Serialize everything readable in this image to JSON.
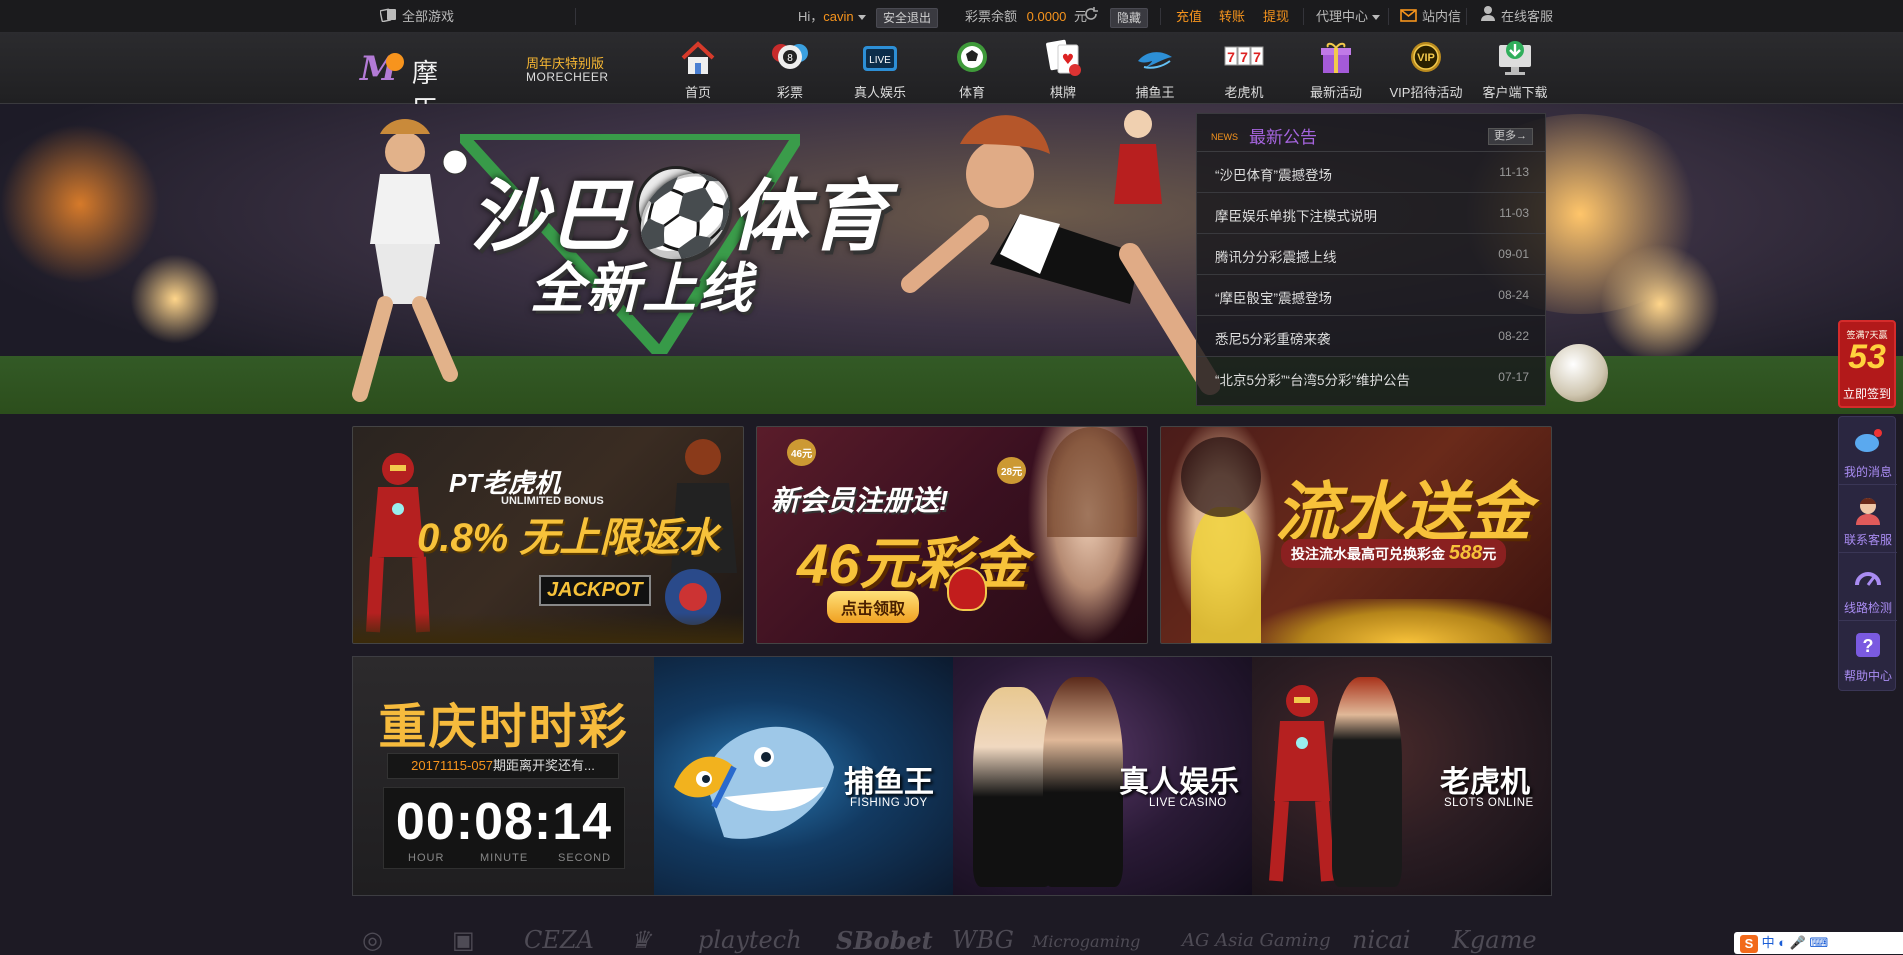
{
  "topbar": {
    "all_games": "全部游戏",
    "greeting": "Hi，",
    "username": "cavin",
    "logout": "安全退出",
    "balance_label": "彩票余额",
    "balance_value": "0.0000",
    "balance_unit": "元",
    "hide": "隐藏",
    "deposit": "充值",
    "transfer": "转账",
    "withdraw": "提现",
    "agent_center": "代理中心",
    "messages": "站内信",
    "online_service": "在线客服"
  },
  "header": {
    "logo_m": "M",
    "logo_name": "摩臣娱乐",
    "logo_edition": "周年庆特别版",
    "logo_en": "MORECHEER",
    "nav": [
      {
        "label": "首页",
        "icon": "house-icon"
      },
      {
        "label": "彩票",
        "icon": "lottery-ball-icon"
      },
      {
        "label": "真人娱乐",
        "icon": "live-tv-icon"
      },
      {
        "label": "体育",
        "icon": "soccer-ball-icon"
      },
      {
        "label": "棋牌",
        "icon": "playing-cards-icon"
      },
      {
        "label": "捕鱼王",
        "icon": "fish-icon"
      },
      {
        "label": "老虎机",
        "icon": "slot-777-icon"
      },
      {
        "label": "最新活动",
        "icon": "gift-icon"
      },
      {
        "label": "VIP招待活动",
        "icon": "vip-badge-icon"
      },
      {
        "label": "客户端下载",
        "icon": "download-icon"
      }
    ]
  },
  "banner": {
    "title": "沙巴⚽体育",
    "subtitle": "全新上线"
  },
  "news": {
    "tag": "NEWS",
    "title": "最新公告",
    "more": "更多→",
    "items": [
      {
        "text": "“沙巴体育”震撼登场",
        "date": "11-13"
      },
      {
        "text": "摩臣娱乐单挑下注模式说明",
        "date": "11-03"
      },
      {
        "text": "腾讯分分彩震撼上线",
        "date": "09-01"
      },
      {
        "text": "“摩臣骰宝”震撼登场",
        "date": "08-24"
      },
      {
        "text": "悉尼5分彩重磅来袭",
        "date": "08-22"
      },
      {
        "text": "“北京5分彩”“台湾5分彩”维护公告",
        "date": "07-17"
      }
    ]
  },
  "promos": {
    "p1_title": "PT老虎机",
    "p1_sub": "UNLIMITED BONUS",
    "p1_main": "0.8% 无上限返水",
    "p1_jackpot": "JACKPOT",
    "p2_title": "新会员注册送!",
    "p2_main": "46元彩金",
    "p2_btn": "点击领取",
    "p2_badge1": "46元",
    "p2_badge2": "28元",
    "p3_main": "流水送金",
    "p3_sub": "投注流水最高可兑换彩金",
    "p3_amount": "588",
    "p3_unit": "元"
  },
  "lottery": {
    "title": "重庆时时彩",
    "period": "20171115-057",
    "period_suffix": "期距离开奖还有...",
    "time": "00:08:14",
    "hour": "HOUR",
    "minute": "MINUTE",
    "second": "SECOND"
  },
  "game_tiles": [
    {
      "cn": "捕鱼王",
      "en": "FISHING JOY"
    },
    {
      "cn": "真人娱乐",
      "en": "LIVE CASINO"
    },
    {
      "cn": "老虎机",
      "en": "SLOTS ONLINE"
    }
  ],
  "partners": [
    "CEZA",
    "playtech",
    "SBobet",
    "WBG",
    "Microgaming",
    "AG Asia Gaming",
    "nicai",
    "Kgame"
  ],
  "side": {
    "sign_top": "签满7天赢",
    "sign_num": "53",
    "sign_btn": "立即签到",
    "items": [
      {
        "label": "我的消息",
        "icon": "message-bubble-icon"
      },
      {
        "label": "联系客服",
        "icon": "customer-service-icon"
      },
      {
        "label": "线路检测",
        "icon": "speed-gauge-icon"
      },
      {
        "label": "帮助中心",
        "icon": "help-question-icon"
      }
    ]
  },
  "ime": {
    "text": "中 ◐ 🎤 ⌨"
  },
  "colors": {
    "accent_orange": "#f7941d",
    "accent_purple": "#a564de",
    "gold": "#f6bb3d"
  }
}
